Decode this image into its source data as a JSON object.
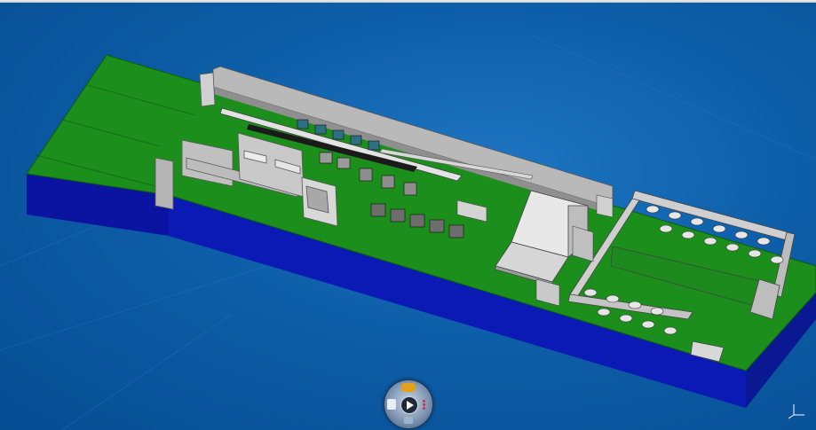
{
  "viewer": {
    "background": "#0d5ea8",
    "slab_color": "#1d8f1d",
    "base_color": "#0b1aa0",
    "wall_color": "#c8c8c8",
    "equipment_color": "#2f6f86"
  },
  "compass": {
    "top_icon": "orbit-icon",
    "center_icon": "play-icon",
    "left_icon": "view-cube-icon",
    "right_icon": "dots-menu-icon",
    "bottom_icon": "pan-icon"
  },
  "axis_triad": {
    "icon": "xyz-axis-icon"
  }
}
